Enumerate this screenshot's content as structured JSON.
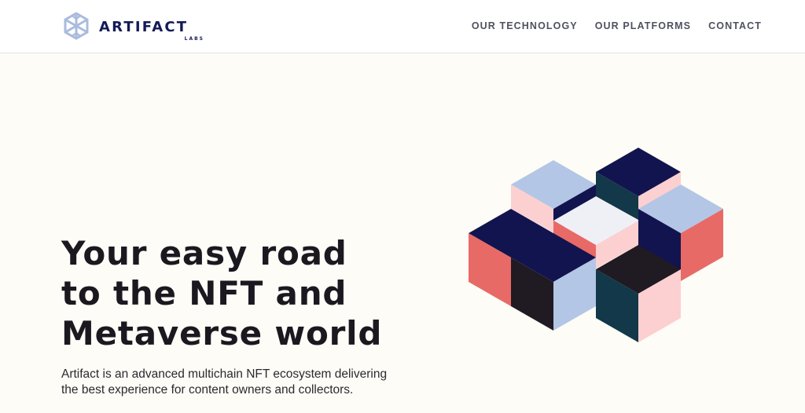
{
  "brand": {
    "name": "ARTIFACT",
    "sub": "LABS",
    "logo_icon": "snowflake-hexagon-icon",
    "color": "#141a56"
  },
  "nav": {
    "items": [
      {
        "label": "OUR TECHNOLOGY"
      },
      {
        "label": "OUR PLATFORMS"
      },
      {
        "label": "CONTACT"
      }
    ]
  },
  "hero": {
    "title_lines": [
      "Your easy road",
      "to the NFT and",
      "Metaverse world"
    ],
    "subtitle_lines": [
      "Artifact is an advanced multichain NFT ecosystem delivering",
      "the best experience for content owners and collectors."
    ]
  },
  "colors": {
    "background": "#fdfcf6",
    "navy": "#12144f",
    "light_blue": "#b4c6e6",
    "pink": "#fcd0d0",
    "coral": "#e86a66",
    "dark": "#201a22",
    "teal": "#123849",
    "light": "#eef0f6"
  }
}
